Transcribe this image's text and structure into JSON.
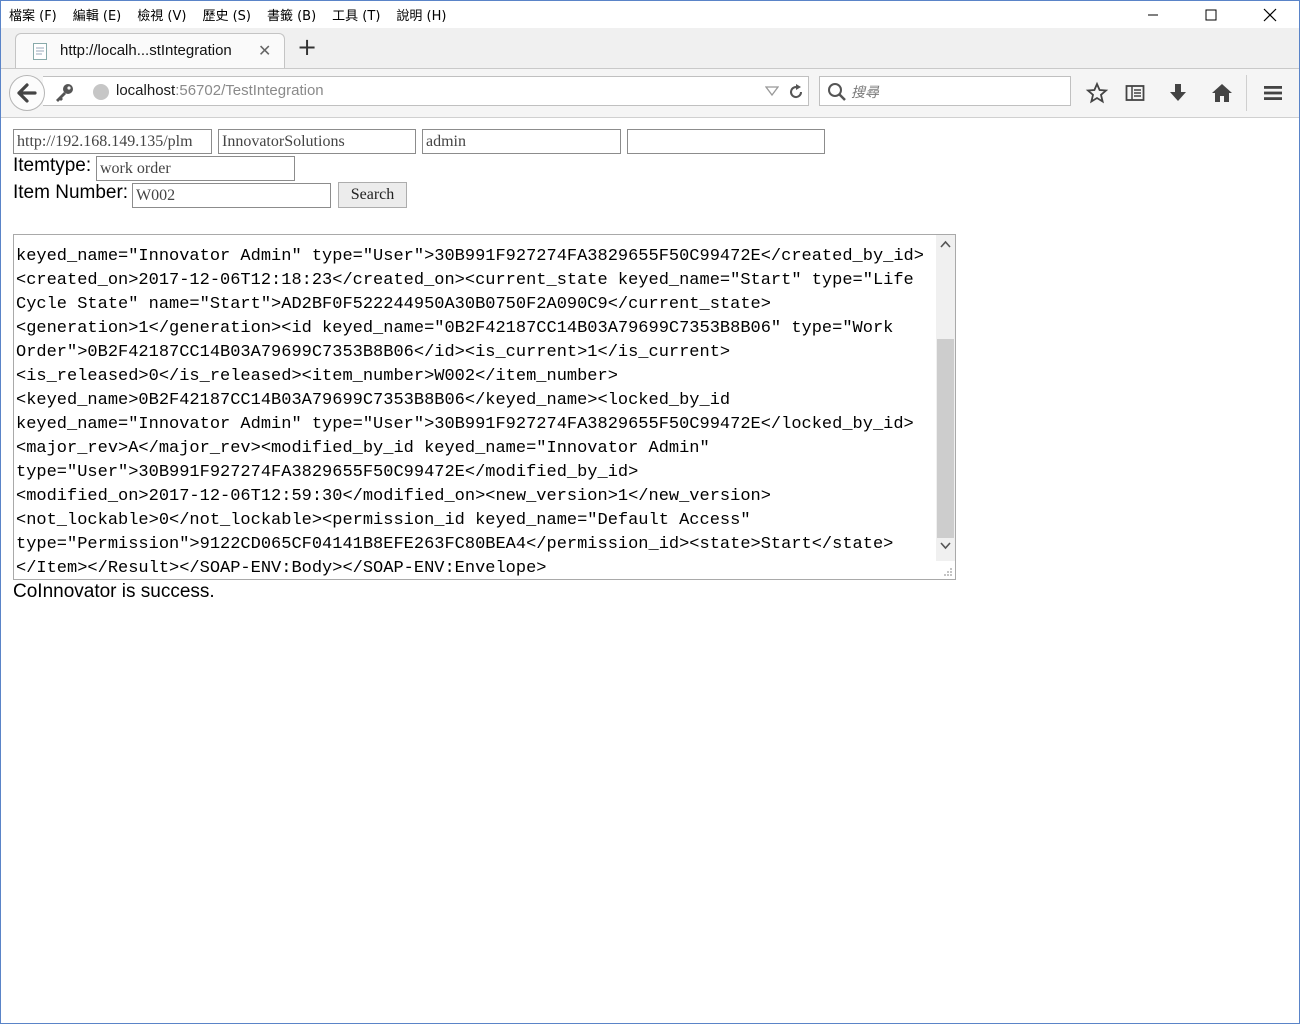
{
  "menu": [
    "檔案 (F)",
    "編輯 (E)",
    "檢視 (V)",
    "歷史 (S)",
    "書籤 (B)",
    "工具 (T)",
    "說明 (H)"
  ],
  "tab": {
    "title": "http://localh...stIntegration"
  },
  "address": {
    "host": "localhost",
    "rest": ":56702/TestIntegration"
  },
  "searchbar": {
    "placeholder": "搜尋"
  },
  "form": {
    "server_url": "http://192.168.149.135/plm",
    "database": "InnovatorSolutions",
    "username": "admin",
    "password": "",
    "itemtype_label": "Itemtype:",
    "itemtype_value": "work order",
    "item_number_label": "Item Number:",
    "item_number_value": "W002",
    "search_button": "Search"
  },
  "result_lines": [
    "keyed_name=\"Innovator Admin\" type=\"User\">30B991F927274FA3829655F50C99472E</created_by_id>",
    "<created_on>2017-12-06T12:18:23</created_on><current_state keyed_name=\"Start\" type=\"Life",
    "Cycle State\" name=\"Start\">AD2BF0F522244950A30B0750F2A090C9</current_state>",
    "<generation>1</generation><id keyed_name=\"0B2F42187CC14B03A79699C7353B8B06\" type=\"Work",
    "Order\">0B2F42187CC14B03A79699C7353B8B06</id><is_current>1</is_current>",
    "<is_released>0</is_released><item_number>W002</item_number>",
    "<keyed_name>0B2F42187CC14B03A79699C7353B8B06</keyed_name><locked_by_id",
    "keyed_name=\"Innovator Admin\" type=\"User\">30B991F927274FA3829655F50C99472E</locked_by_id>",
    "<major_rev>A</major_rev><modified_by_id keyed_name=\"Innovator Admin\"",
    "type=\"User\">30B991F927274FA3829655F50C99472E</modified_by_id>",
    "<modified_on>2017-12-06T12:59:30</modified_on><new_version>1</new_version>",
    "<not_lockable>0</not_lockable><permission_id keyed_name=\"Default Access\"",
    "type=\"Permission\">9122CD065CF04141B8EFE263FC80BEA4</permission_id><state>Start</state>",
    "</Item></Result></SOAP-ENV:Body></SOAP-ENV:Envelope>"
  ],
  "status_text": "CoInnovator is success."
}
